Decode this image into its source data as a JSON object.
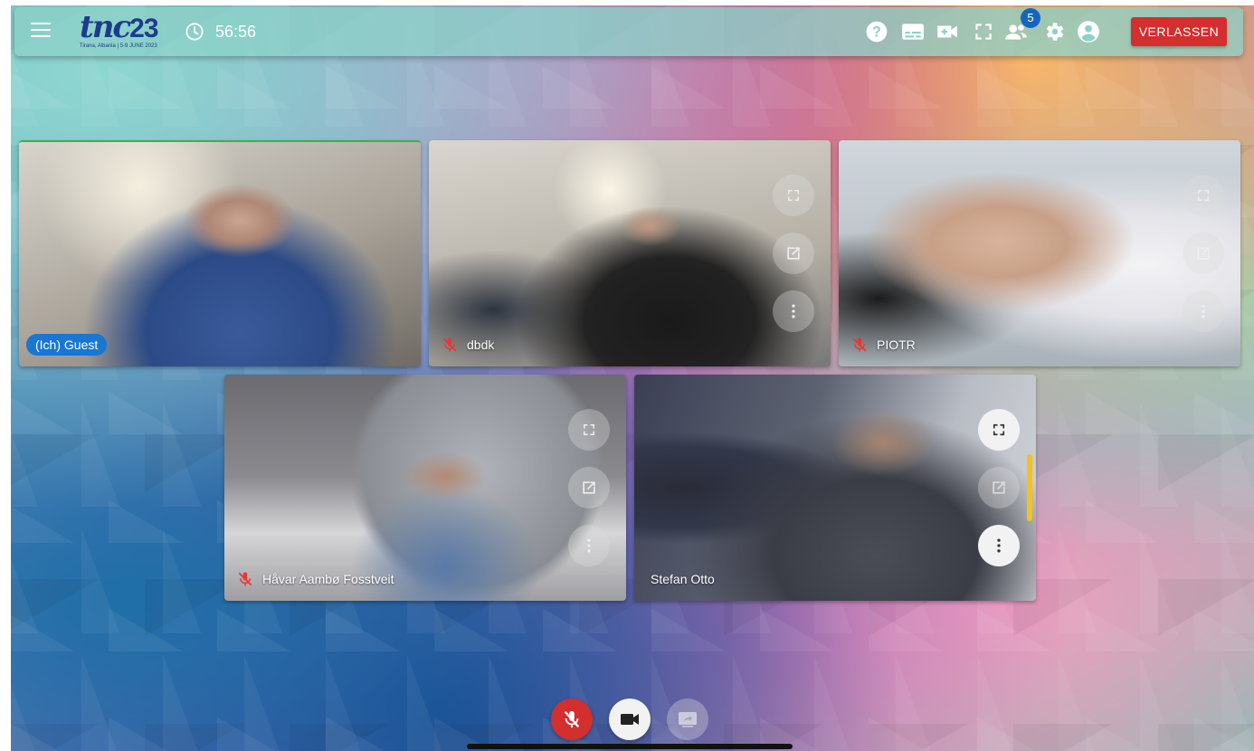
{
  "header": {
    "logo": {
      "mark": "tnc",
      "year": "23",
      "subtitle": "Tirana, Albania | 5-9 JUNE 2023"
    },
    "timer": "56:56",
    "participants_badge": "5",
    "leave_label": "VERLASSEN",
    "icons": [
      "menu-icon",
      "clock-icon",
      "help-icon",
      "subtitles-icon",
      "add-video-icon",
      "fullscreen-icon",
      "participants-icon",
      "settings-icon",
      "account-icon"
    ]
  },
  "participants": [
    {
      "name": "(Ich) Guest",
      "self": true,
      "muted": false
    },
    {
      "name": "dbdk",
      "self": false,
      "muted": true
    },
    {
      "name": "PIOTR",
      "self": false,
      "muted": true
    },
    {
      "name": "Håvar Aambø Fosstveit",
      "self": false,
      "muted": true
    },
    {
      "name": "Stefan Otto",
      "self": false,
      "muted": false,
      "speaking": true
    }
  ],
  "controls": {
    "mic": {
      "state": "muted",
      "color": "#d32f2f"
    },
    "camera": {
      "state": "on"
    },
    "screenshare": {
      "state": "disabled"
    }
  },
  "colors": {
    "accent": "#1976d2",
    "leave": "#d32f2f",
    "speaking": "#f4c21c",
    "badge": "#1565c0"
  }
}
